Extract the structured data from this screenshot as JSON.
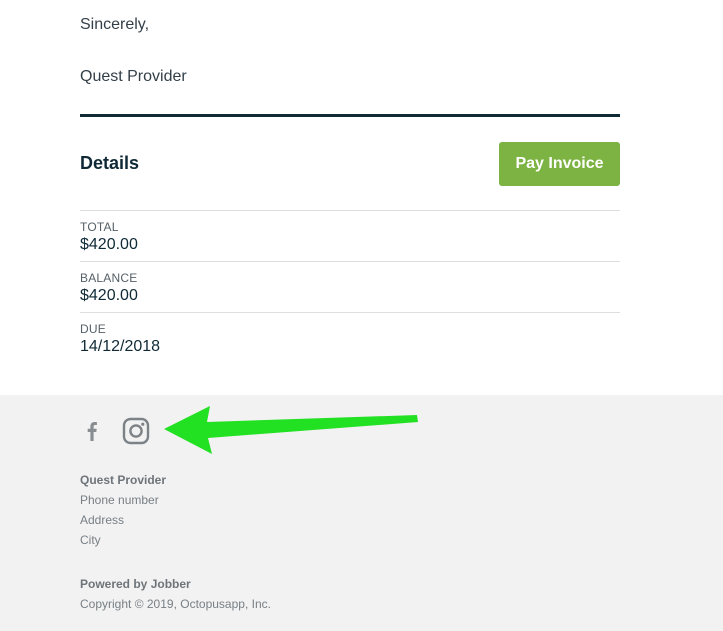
{
  "letter": {
    "closing": "Sincerely,",
    "signature": "Quest Provider"
  },
  "details": {
    "title": "Details",
    "pay_button_label": "Pay Invoice",
    "rows": [
      {
        "label": "TOTAL",
        "value": "$420.00"
      },
      {
        "label": "BALANCE",
        "value": "$420.00"
      },
      {
        "label": "DUE",
        "value": "14/12/2018"
      }
    ]
  },
  "footer": {
    "social_icons": [
      "facebook-icon",
      "instagram-icon"
    ],
    "company_name": "Quest Provider",
    "phone": "Phone number",
    "address": "Address",
    "city": "City",
    "powered_by": "Powered by Jobber",
    "copyright": "Copyright © 2019, Octopusapp, Inc."
  },
  "colors": {
    "accent_green": "#7db343",
    "dark_navy": "#0f2a36",
    "annotation_arrow": "#22e022",
    "footer_bg": "#f2f2f2"
  }
}
